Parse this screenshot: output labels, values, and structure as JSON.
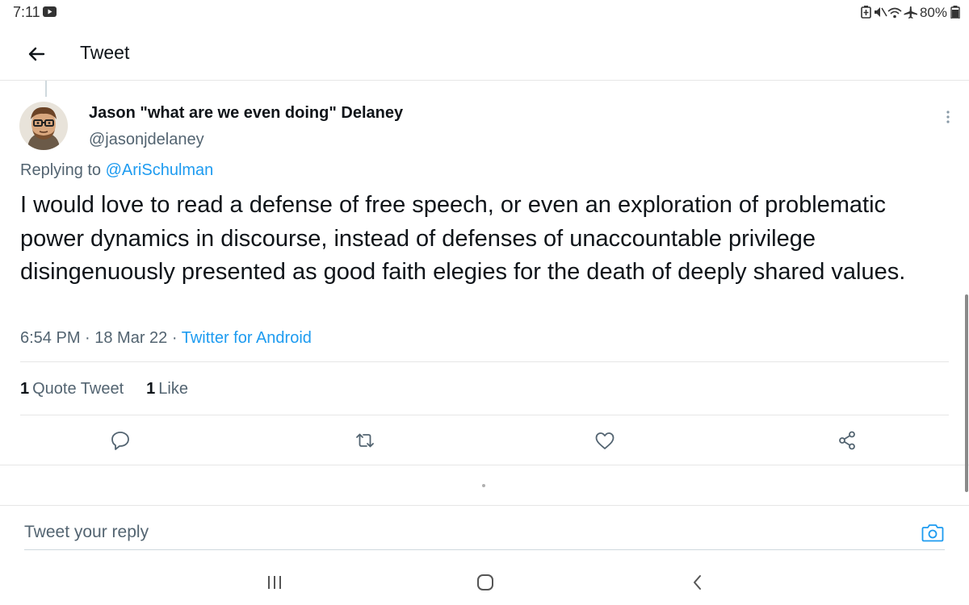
{
  "status_bar": {
    "time": "7:11",
    "battery_percent": "80%",
    "icons": [
      "youtube-notification-icon",
      "battery-saver-icon",
      "mute-icon",
      "wifi-icon",
      "airplane-icon",
      "battery-icon"
    ]
  },
  "header": {
    "title": "Tweet"
  },
  "tweet": {
    "display_name": "Jason \"what are we even doing\" Delaney",
    "handle": "@jasonjdelaney",
    "replying_prefix": "Replying to ",
    "replying_to": "@AriSchulman",
    "text": "I would love to read a defense of free speech, or even an exploration of problematic power dynamics in discourse, instead of defenses of unaccountable privilege disingenuously presented as good faith elegies for the death of deeply shared values.",
    "timestamp": "6:54 PM · 18 Mar 22 · ",
    "source": "Twitter for Android"
  },
  "stats": {
    "quote_count": "1",
    "quote_label": "Quote Tweet",
    "like_count": "1",
    "like_label": "Like"
  },
  "actions": [
    "reply-icon",
    "retweet-icon",
    "like-icon",
    "share-icon"
  ],
  "composer": {
    "placeholder": "Tweet your reply",
    "value": ""
  },
  "colors": {
    "accent": "#1d9bf0",
    "text_primary": "#0f1419",
    "text_secondary": "#536471",
    "divider": "#e6e6e6"
  }
}
